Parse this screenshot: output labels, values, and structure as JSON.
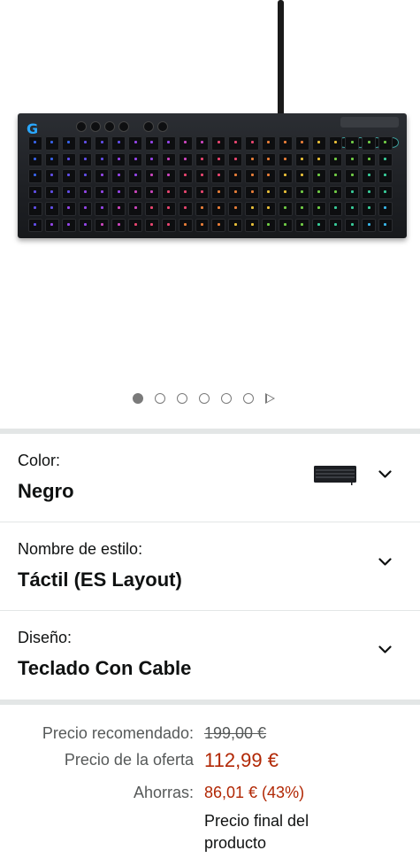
{
  "gallery": {
    "image_alt": "Teclado mecánico para juegos negro",
    "indicator": {
      "active_index": 0,
      "dot_count": 6,
      "play_icon": "play-icon"
    }
  },
  "variations": [
    {
      "label": "Color:",
      "value": "Negro",
      "icon": "chevron-down-icon",
      "swatch": true
    },
    {
      "label": "Nombre de estilo:",
      "value": "Táctil (ES Layout)",
      "icon": "chevron-down-icon"
    },
    {
      "label": "Diseño:",
      "value": "Teclado Con Cable",
      "icon": "chevron-down-icon"
    }
  ],
  "pricing": {
    "list_label": "Precio recomendado:",
    "list_price": "199,00 €",
    "deal_label": "Precio de la oferta",
    "deal_price": "112,99 €",
    "savings_label": "Ahorras:",
    "savings_value": "86,01 € (43%)",
    "final_note": "Precio final del producto"
  },
  "colors": {
    "deal_red": "#b12704",
    "muted_text": "#565959",
    "separator": "#e3e6e6"
  }
}
